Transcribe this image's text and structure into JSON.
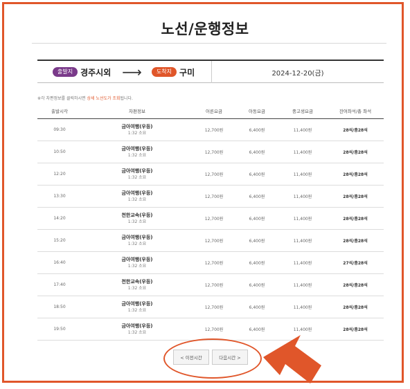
{
  "page": {
    "title": "노선/운행정보"
  },
  "route": {
    "departure_badge": "출발지",
    "departure": "경주시외",
    "arrival_badge": "도착지",
    "arrival": "구미",
    "date": "2024-12-20(금)"
  },
  "notice": {
    "prefix": "※각 차편정보를 클릭하시면 ",
    "highlight": "상세 노선도가 조회",
    "suffix": "됩니다."
  },
  "table": {
    "headers": [
      "출발시각",
      "차편정보",
      "어른요금",
      "아동요금",
      "중고생요금",
      "잔여좌석/총 좌석"
    ],
    "rows": [
      {
        "time": "09:30",
        "grade": "금아여행(우등)",
        "duration": "1:32 소요",
        "adult": "12,700원",
        "child": "6,400원",
        "student": "11,400원",
        "seats": "28석/총28석"
      },
      {
        "time": "10:50",
        "grade": "금아여행(우등)",
        "duration": "1:32 소요",
        "adult": "12,700원",
        "child": "6,400원",
        "student": "11,400원",
        "seats": "28석/총28석"
      },
      {
        "time": "12:20",
        "grade": "금아여행(우등)",
        "duration": "1:32 소요",
        "adult": "12,700원",
        "child": "6,400원",
        "student": "11,400원",
        "seats": "28석/총28석"
      },
      {
        "time": "13:30",
        "grade": "금아여행(우등)",
        "duration": "1:32 소요",
        "adult": "12,700원",
        "child": "6,400원",
        "student": "11,400원",
        "seats": "28석/총28석"
      },
      {
        "time": "14:20",
        "grade": "천한교속(우등)",
        "duration": "1:32 소요",
        "adult": "12,700원",
        "child": "6,400원",
        "student": "11,400원",
        "seats": "28석/총28석"
      },
      {
        "time": "15:20",
        "grade": "금아여행(우등)",
        "duration": "1:32 소요",
        "adult": "12,700원",
        "child": "6,400원",
        "student": "11,400원",
        "seats": "28석/총28석"
      },
      {
        "time": "16:40",
        "grade": "금아여행(우등)",
        "duration": "1:32 소요",
        "adult": "12,700원",
        "child": "6,400원",
        "student": "11,400원",
        "seats": "27석/총28석"
      },
      {
        "time": "17:40",
        "grade": "천한교속(우등)",
        "duration": "1:32 소요",
        "adult": "12,700원",
        "child": "6,400원",
        "student": "11,400원",
        "seats": "28석/총28석"
      },
      {
        "time": "18:50",
        "grade": "금아여행(우등)",
        "duration": "1:32 소요",
        "adult": "12,700원",
        "child": "6,400원",
        "student": "11,400원",
        "seats": "28석/총28석"
      },
      {
        "time": "19:50",
        "grade": "금아여행(우등)",
        "duration": "1:32 소요",
        "adult": "12,700원",
        "child": "6,400원",
        "student": "11,400원",
        "seats": "28석/총28석"
      }
    ]
  },
  "pager": {
    "prev_label": "< 이전시간",
    "next_label": "다음시간 >"
  },
  "colors": {
    "accent": "#e0562a",
    "departure_badge": "#7a3a8a"
  },
  "icons": {
    "route_arrow": "arrow-right-icon",
    "callout": "callout-arrow-icon"
  }
}
